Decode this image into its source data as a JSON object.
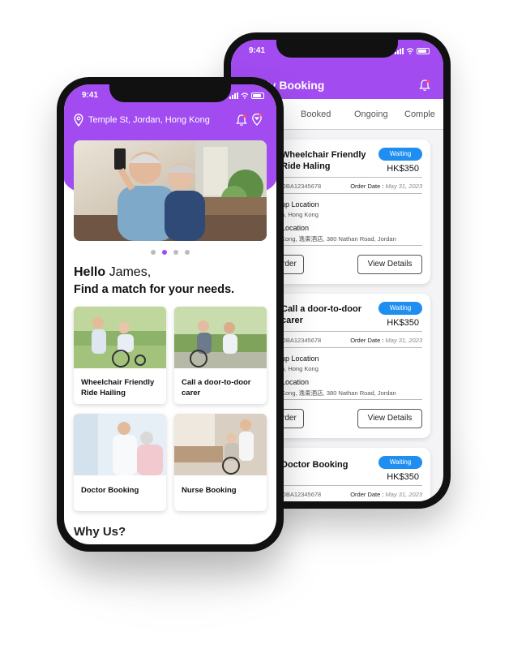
{
  "colors": {
    "brand_purple": "#a14bf0",
    "badge_blue": "#1f8ef1"
  },
  "back_phone": {
    "status_time": "9:41",
    "title": "My Booking",
    "back_icon": "arrow-left-icon",
    "bell_icon": "bell-icon",
    "tabs": [
      "Booked",
      "Ongoing",
      "Comple"
    ],
    "bookings": [
      {
        "title": "Wheelchair Friendly Ride Haling",
        "status": "Waiting",
        "price": "HK$350",
        "ref": "OBA12345678",
        "order_date_label": "Order Date :",
        "order_date": "May 31, 2023",
        "pickup_label": "up Location",
        "pickup_value": "n, Hong Kong",
        "dropoff_label": "Location",
        "dropoff_value": "Kong, 逸東酒店, 380 Nathan Road, Jordan",
        "order_btn": "Order",
        "details_btn": "View Details"
      },
      {
        "title": "Call a door-to-door carer",
        "status": "Waiting",
        "price": "HK$350",
        "ref": "OBA12345678",
        "order_date_label": "Order Date :",
        "order_date": "May 31, 2023",
        "pickup_label": "up Location",
        "pickup_value": "n, Hong Kong",
        "dropoff_label": "Location",
        "dropoff_value": "Kong, 逸東酒店, 380 Nathan Road, Jordan",
        "order_btn": "Order",
        "details_btn": "View Details"
      },
      {
        "title": "Doctor Booking",
        "status": "Waiting",
        "price": "HK$350",
        "ref": "OBA12345678",
        "order_date_label": "Order Date :",
        "order_date": "May 31, 2023"
      }
    ]
  },
  "front_phone": {
    "status_time": "9:41",
    "location": "Temple St, Jordan, Hong Kong",
    "location_icon": "location-pin-icon",
    "bell_icon": "bell-icon",
    "favorite_icon": "heart-pin-icon",
    "carousel_dots": 4,
    "carousel_active_index": 1,
    "greeting_prefix": "Hello",
    "greeting_name": "James,",
    "subheading": "Find a match for your needs.",
    "services": [
      {
        "label": "Wheelchair Friendly Ride Hailing"
      },
      {
        "label": "Call a door-to-door carer"
      },
      {
        "label": "Doctor Booking"
      },
      {
        "label": "Nurse Booking"
      }
    ],
    "why_us": "Why Us?"
  }
}
